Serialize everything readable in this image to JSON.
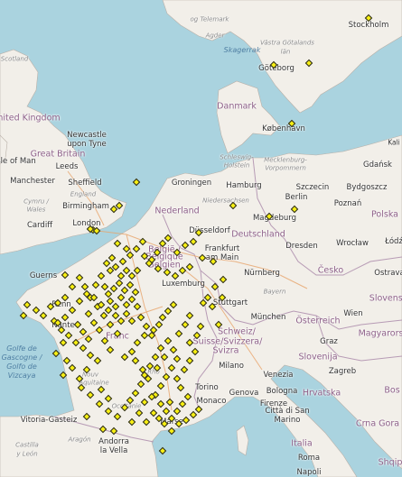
{
  "map": {
    "marker_color": "#f6ee12",
    "sea_color": "#aad3df",
    "land_color": "#f2efe9",
    "labels": [
      {
        "id": "stockholm",
        "text": "Stockholm",
        "cls": ""
      },
      {
        "id": "sverige-fragment",
        "text": "og Telemark",
        "cls": "region"
      },
      {
        "id": "agder",
        "text": "Agder",
        "cls": "region"
      },
      {
        "id": "vastra-gotaland",
        "text": "Västra Götalands",
        "cls": "region"
      },
      {
        "id": "skagerrak",
        "text": "Skagerrak",
        "cls": "sea"
      },
      {
        "id": "lan",
        "text": "län",
        "cls": "region"
      },
      {
        "id": "goteborg",
        "text": "Göteborg",
        "cls": ""
      },
      {
        "id": "scotland",
        "text": "Scotland",
        "cls": "region"
      },
      {
        "id": "united-kingdom",
        "text": "nited Kingdom",
        "cls": "country"
      },
      {
        "id": "danmark",
        "text": "Danmark",
        "cls": "country"
      },
      {
        "id": "kobenhavn",
        "text": "København",
        "cls": ""
      },
      {
        "id": "newcastle",
        "text": "Newcastle",
        "cls": ""
      },
      {
        "id": "upon-tyne",
        "text": "upon Tyne",
        "cls": ""
      },
      {
        "id": "great-britain",
        "text": "Great Britain",
        "cls": "country"
      },
      {
        "id": "sle-of-man",
        "text": "sle of Man",
        "cls": ""
      },
      {
        "id": "leeds",
        "text": "Leeds",
        "cls": ""
      },
      {
        "id": "schleswig",
        "text": "Schleswig-",
        "cls": "region"
      },
      {
        "id": "holstein",
        "text": "Holstein",
        "cls": "region"
      },
      {
        "id": "mecklenburg",
        "text": "Mecklenburg-",
        "cls": "region"
      },
      {
        "id": "vorpommern",
        "text": "Vorpommern",
        "cls": "region"
      },
      {
        "id": "gdansk",
        "text": "Gdańsk",
        "cls": ""
      },
      {
        "id": "kali",
        "text": "Kali",
        "cls": ""
      },
      {
        "id": "manchester",
        "text": "Manchester",
        "cls": ""
      },
      {
        "id": "sheffield",
        "text": "Sheffield",
        "cls": ""
      },
      {
        "id": "groningen",
        "text": "Groningen",
        "cls": ""
      },
      {
        "id": "hamburg",
        "text": "Hamburg",
        "cls": ""
      },
      {
        "id": "szczecin",
        "text": "Szczecin",
        "cls": ""
      },
      {
        "id": "bydgoszcz",
        "text": "Bydgoszcz",
        "cls": ""
      },
      {
        "id": "england",
        "text": "England",
        "cls": "region"
      },
      {
        "id": "cymru",
        "text": "Cymru /",
        "cls": "region"
      },
      {
        "id": "wales",
        "text": "Wales",
        "cls": "region"
      },
      {
        "id": "birmingham",
        "text": "Birmingham",
        "cls": ""
      },
      {
        "id": "niedersachsen",
        "text": "Niedersachsen",
        "cls": "region"
      },
      {
        "id": "berlin",
        "text": "Berlin",
        "cls": ""
      },
      {
        "id": "poznan",
        "text": "Poznań",
        "cls": ""
      },
      {
        "id": "cardiff",
        "text": "Cardiff",
        "cls": ""
      },
      {
        "id": "london",
        "text": "London",
        "cls": ""
      },
      {
        "id": "nederland",
        "text": "Nederland",
        "cls": "country"
      },
      {
        "id": "magdeburg",
        "text": "Magdeburg",
        "cls": ""
      },
      {
        "id": "polska",
        "text": "Polska",
        "cls": "country"
      },
      {
        "id": "dusseldorf",
        "text": "Düsseldorf",
        "cls": ""
      },
      {
        "id": "deutschland",
        "text": "Deutschland",
        "cls": "country"
      },
      {
        "id": "dresden",
        "text": "Dresden",
        "cls": ""
      },
      {
        "id": "wroclaw",
        "text": "Wrocław",
        "cls": ""
      },
      {
        "id": "lodz",
        "text": "Łódź",
        "cls": ""
      },
      {
        "id": "frankfurt",
        "text": "Frankfurt",
        "cls": ""
      },
      {
        "id": "am-main",
        "text": "am Main",
        "cls": ""
      },
      {
        "id": "belgie",
        "text": "België /",
        "cls": "country"
      },
      {
        "id": "belgique",
        "text": "Belgique",
        "cls": "country"
      },
      {
        "id": "belgien",
        "text": "Belgien",
        "cls": "country"
      },
      {
        "id": "guernsey",
        "text": "Guerns",
        "cls": ""
      },
      {
        "id": "nurnberg",
        "text": "Nürnberg",
        "cls": ""
      },
      {
        "id": "cesko",
        "text": "Česko",
        "cls": "country"
      },
      {
        "id": "luxembourg",
        "text": "Luxemburg",
        "cls": ""
      },
      {
        "id": "bayern",
        "text": "Bayern",
        "cls": "region"
      },
      {
        "id": "ostrava",
        "text": "Ostrava",
        "cls": ""
      },
      {
        "id": "slovensko",
        "text": "Slovensk",
        "cls": "country"
      },
      {
        "id": "rennes",
        "text": "Renn",
        "cls": ""
      },
      {
        "id": "stuttgart",
        "text": "Stuttgart",
        "cls": ""
      },
      {
        "id": "munchen",
        "text": "München",
        "cls": ""
      },
      {
        "id": "osterreich",
        "text": "Österreich",
        "cls": "country"
      },
      {
        "id": "wien",
        "text": "Wien",
        "cls": ""
      },
      {
        "id": "nantes",
        "text": "Nante",
        "cls": ""
      },
      {
        "id": "france",
        "text": "Franc",
        "cls": "country"
      },
      {
        "id": "schweiz",
        "text": "Schweiz/",
        "cls": "country"
      },
      {
        "id": "suisse",
        "text": "Suisse/Svizzera/",
        "cls": "country"
      },
      {
        "id": "svizra",
        "text": "Svizra",
        "cls": "country"
      },
      {
        "id": "magyarorszag",
        "text": "Magyarorsz",
        "cls": "country"
      },
      {
        "id": "graz",
        "text": "Graz",
        "cls": ""
      },
      {
        "id": "golfe",
        "text": "Golfe de",
        "cls": "sea"
      },
      {
        "id": "gascogne",
        "text": "Gascogne /",
        "cls": "sea"
      },
      {
        "id": "golfo",
        "text": "Golfo de",
        "cls": "sea"
      },
      {
        "id": "vizcaya",
        "text": "Vizcaya",
        "cls": "sea"
      },
      {
        "id": "slovenija",
        "text": "Slovenija",
        "cls": "country"
      },
      {
        "id": "milano",
        "text": "Milano",
        "cls": ""
      },
      {
        "id": "venezia",
        "text": "Venezia",
        "cls": ""
      },
      {
        "id": "zagreb",
        "text": "Zagreb",
        "cls": ""
      },
      {
        "id": "torino",
        "text": "Torino",
        "cls": ""
      },
      {
        "id": "nouvelle",
        "text": "Nouv",
        "cls": "region"
      },
      {
        "id": "aquitaine",
        "text": "Aquitaine",
        "cls": "region"
      },
      {
        "id": "rhone",
        "text": "Rhô",
        "cls": "region"
      },
      {
        "id": "genova",
        "text": "Genova",
        "cls": ""
      },
      {
        "id": "bologna",
        "text": "Bologna",
        "cls": ""
      },
      {
        "id": "hrvatska",
        "text": "Hrvatska",
        "cls": "country"
      },
      {
        "id": "monaco",
        "text": "Monaco",
        "cls": ""
      },
      {
        "id": "firenze",
        "text": "Firenze",
        "cls": ""
      },
      {
        "id": "bih",
        "text": "Bos",
        "cls": "country"
      },
      {
        "id": "occitanie",
        "text": "Occitanie",
        "cls": "region"
      },
      {
        "id": "citta-san-marino",
        "text": "Città di San",
        "cls": ""
      },
      {
        "id": "san-marino",
        "text": "Marino",
        "cls": ""
      },
      {
        "id": "vitoria",
        "text": "Vitoria-Gasteiz",
        "cls": ""
      },
      {
        "id": "marseille",
        "text": "Marse",
        "cls": ""
      },
      {
        "id": "crna-gora",
        "text": "Crna Gora",
        "cls": "country"
      },
      {
        "id": "castilla",
        "text": "Castilla",
        "cls": "region"
      },
      {
        "id": "y-leon",
        "text": "y León",
        "cls": "region"
      },
      {
        "id": "aragon",
        "text": "Aragón",
        "cls": "region"
      },
      {
        "id": "andorra",
        "text": "Andorra",
        "cls": ""
      },
      {
        "id": "la-vella",
        "text": "la Vella",
        "cls": ""
      },
      {
        "id": "italia",
        "text": "Italia",
        "cls": "country"
      },
      {
        "id": "roma",
        "text": "Roma",
        "cls": ""
      },
      {
        "id": "napoli",
        "text": "Napoli",
        "cls": ""
      },
      {
        "id": "shqip",
        "text": "Shqip",
        "cls": "country"
      }
    ]
  }
}
